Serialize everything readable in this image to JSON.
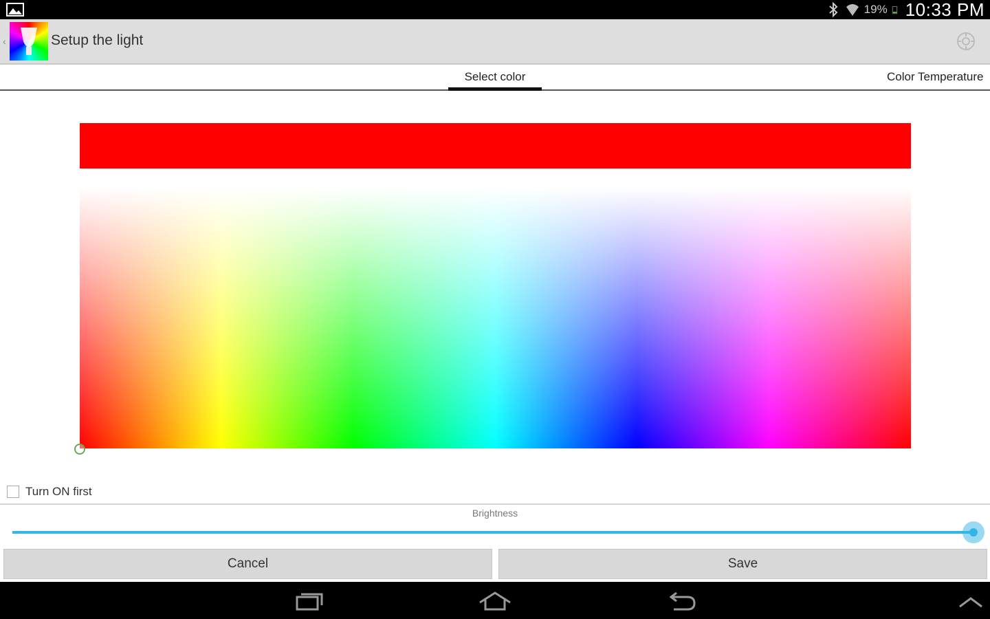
{
  "status_bar": {
    "battery_percent": "19%",
    "clock": "10:33 PM",
    "icons": [
      "gallery-icon",
      "bluetooth-icon",
      "wifi-icon",
      "battery-icon"
    ]
  },
  "action_bar": {
    "title": "Setup the light",
    "icons": [
      "app-bulb-icon",
      "settings-icon"
    ]
  },
  "tabs": [
    {
      "label": "Select color",
      "selected": true
    },
    {
      "label": "Color Temperature",
      "selected": false
    }
  ],
  "color": {
    "selected_color": "#ff0000"
  },
  "turn_on_first": {
    "label": "Turn ON first",
    "checked": false
  },
  "brightness": {
    "label": "Brightness",
    "value_fraction": 1.0,
    "accent_color": "#33b5e5"
  },
  "buttons": {
    "cancel": "Cancel",
    "save": "Save"
  },
  "nav_bar": {
    "icons": [
      "recent-apps-icon",
      "home-icon",
      "back-icon",
      "chevron-up-icon"
    ]
  }
}
